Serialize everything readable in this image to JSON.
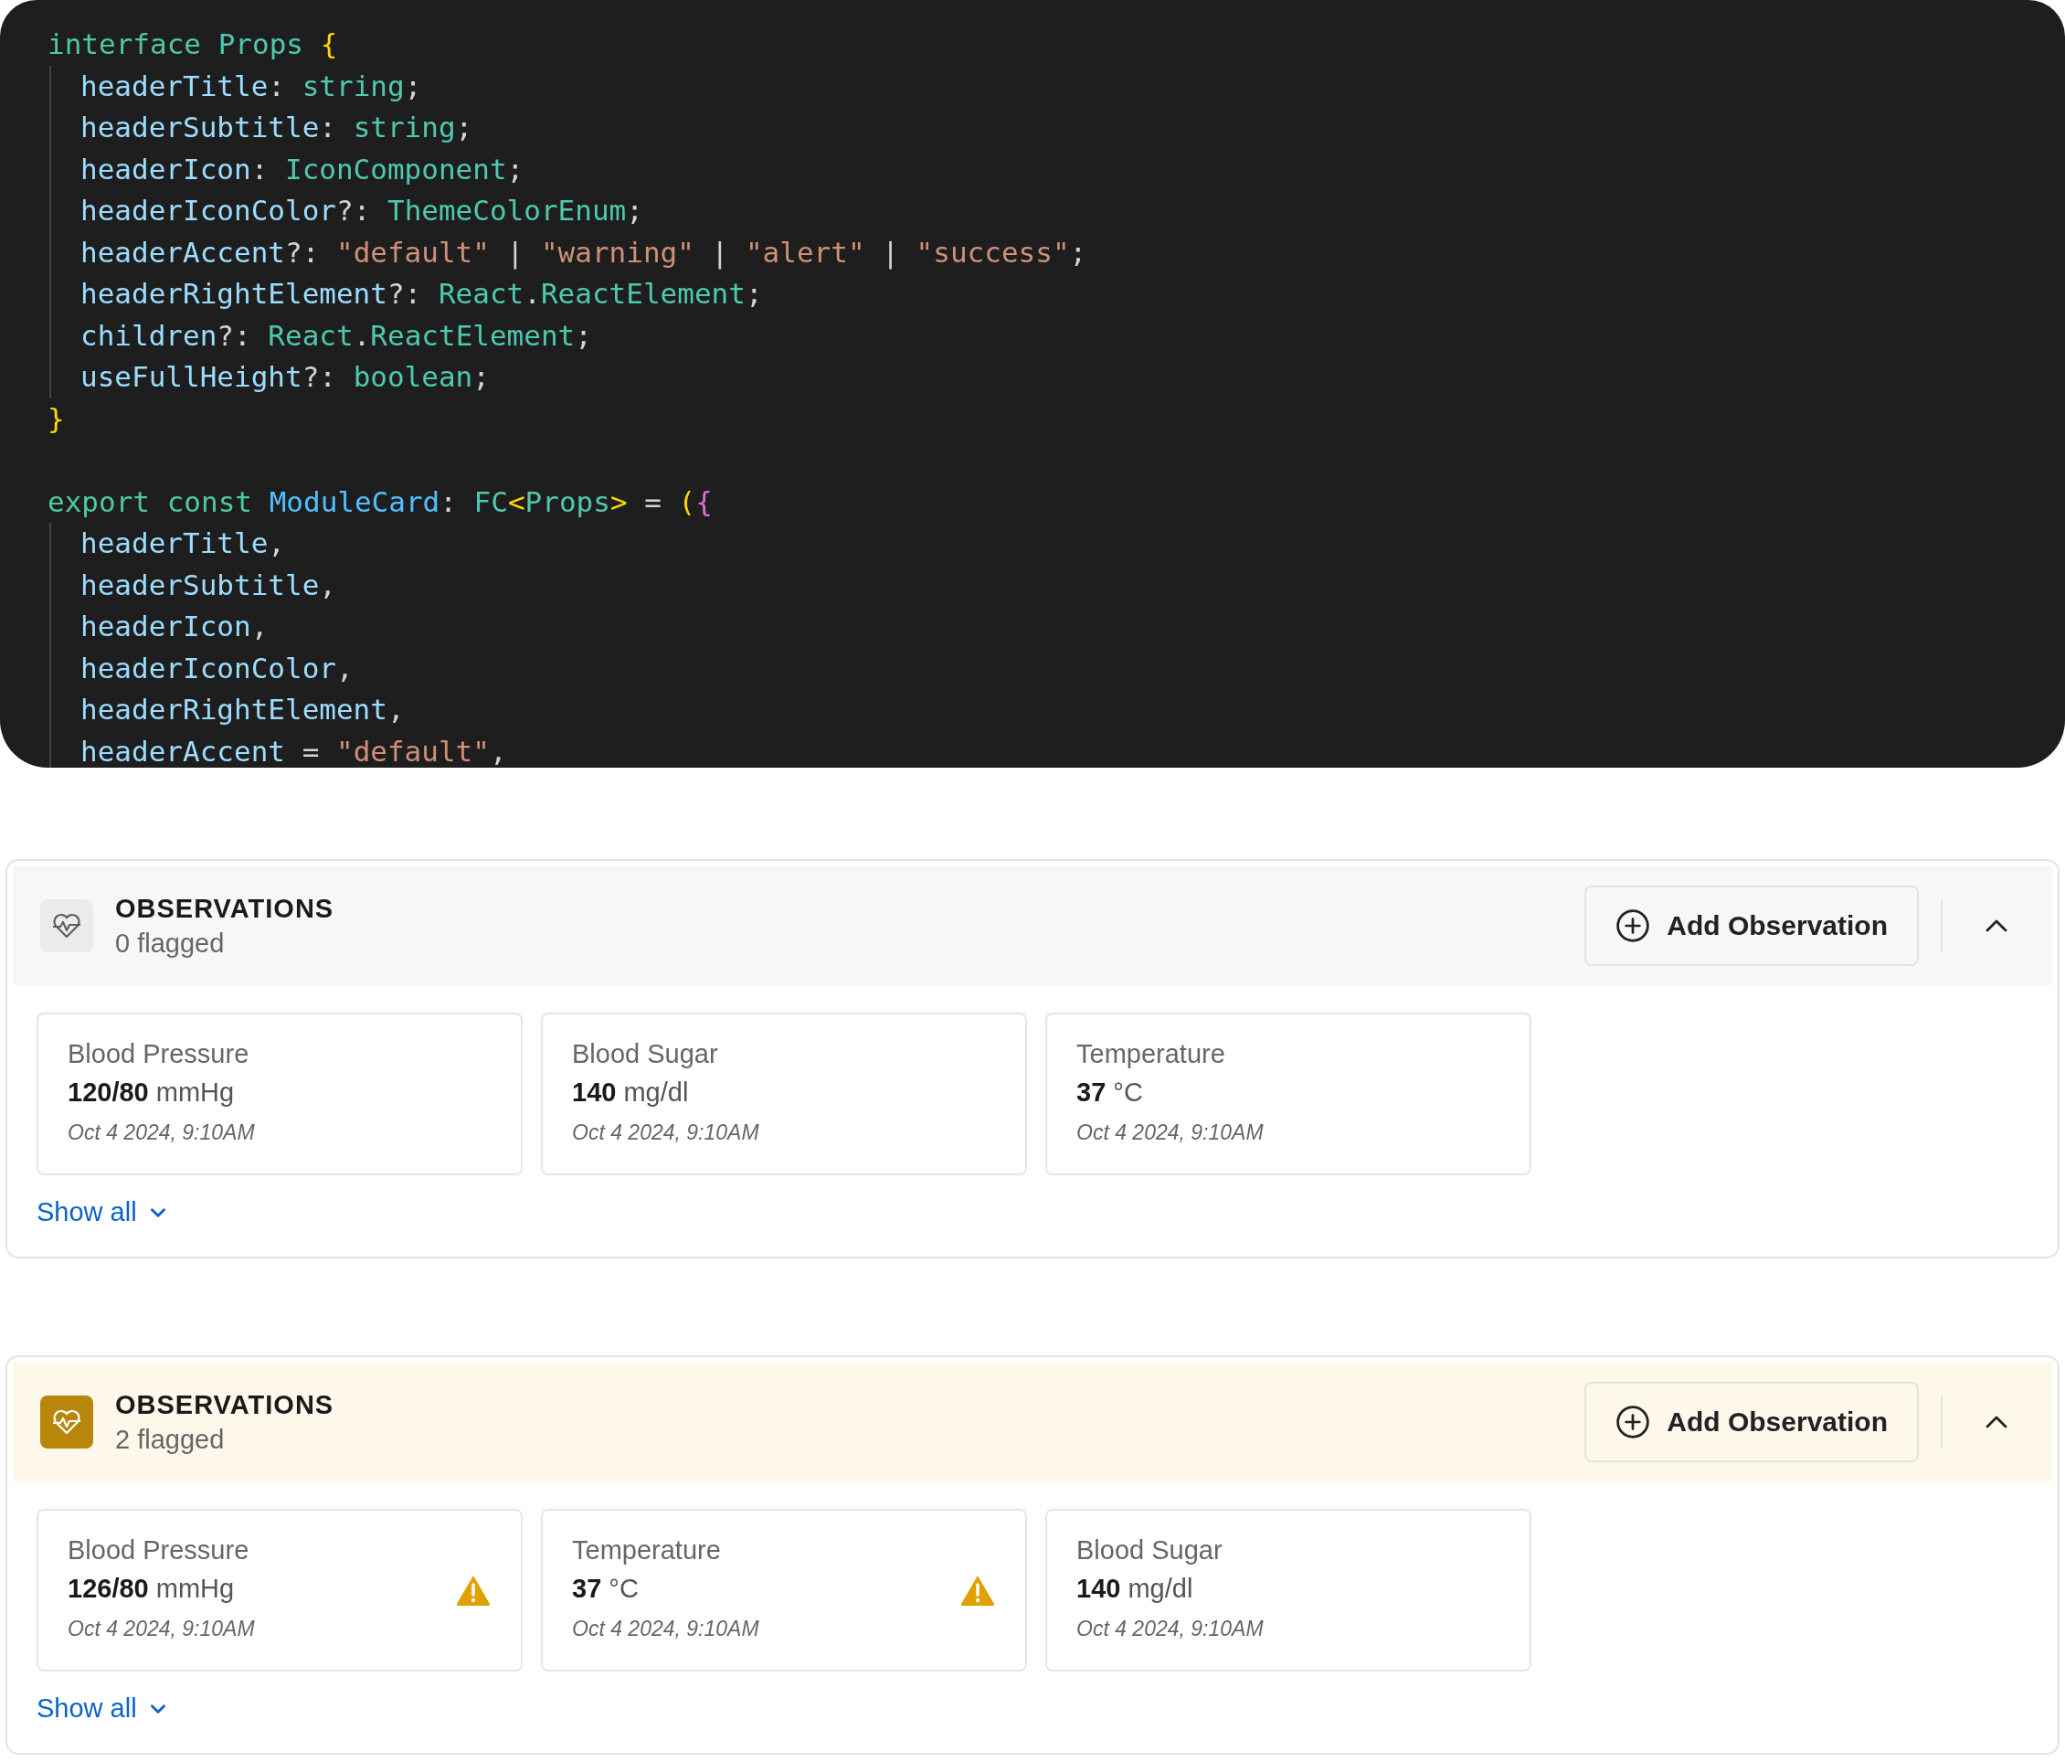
{
  "code": {
    "blocks": [
      {
        "head": [
          {
            "text": "interface ",
            "kind": "keyword"
          },
          {
            "text": "Props ",
            "kind": "type"
          },
          {
            "text": "{",
            "kind": "brace"
          }
        ],
        "children": [
          [
            {
              "text": "headerTitle",
              "kind": "prop"
            },
            {
              "text": ": ",
              "kind": "punct"
            },
            {
              "text": "string",
              "kind": "type"
            },
            {
              "text": ";",
              "kind": "punct"
            }
          ],
          [
            {
              "text": "headerSubtitle",
              "kind": "prop"
            },
            {
              "text": ": ",
              "kind": "punct"
            },
            {
              "text": "string",
              "kind": "type"
            },
            {
              "text": ";",
              "kind": "punct"
            }
          ],
          [
            {
              "text": "headerIcon",
              "kind": "prop"
            },
            {
              "text": ": ",
              "kind": "punct"
            },
            {
              "text": "IconComponent",
              "kind": "type"
            },
            {
              "text": ";",
              "kind": "punct"
            }
          ],
          [
            {
              "text": "headerIconColor",
              "kind": "prop"
            },
            {
              "text": "?: ",
              "kind": "punct"
            },
            {
              "text": "ThemeColorEnum",
              "kind": "type"
            },
            {
              "text": ";",
              "kind": "punct"
            }
          ],
          [
            {
              "text": "headerAccent",
              "kind": "prop"
            },
            {
              "text": "?: ",
              "kind": "punct"
            },
            {
              "text": "\"default\"",
              "kind": "string"
            },
            {
              "text": " | ",
              "kind": "punct"
            },
            {
              "text": "\"warning\"",
              "kind": "string"
            },
            {
              "text": " | ",
              "kind": "punct"
            },
            {
              "text": "\"alert\"",
              "kind": "string"
            },
            {
              "text": " | ",
              "kind": "punct"
            },
            {
              "text": "\"success\"",
              "kind": "string"
            },
            {
              "text": ";",
              "kind": "punct"
            }
          ],
          [
            {
              "text": "headerRightElement",
              "kind": "prop"
            },
            {
              "text": "?: ",
              "kind": "punct"
            },
            {
              "text": "React",
              "kind": "type"
            },
            {
              "text": ".",
              "kind": "punct"
            },
            {
              "text": "ReactElement",
              "kind": "type"
            },
            {
              "text": ";",
              "kind": "punct"
            }
          ],
          [
            {
              "text": "children",
              "kind": "prop"
            },
            {
              "text": "?: ",
              "kind": "punct"
            },
            {
              "text": "React",
              "kind": "type"
            },
            {
              "text": ".",
              "kind": "punct"
            },
            {
              "text": "ReactElement",
              "kind": "type"
            },
            {
              "text": ";",
              "kind": "punct"
            }
          ],
          [
            {
              "text": "useFullHeight",
              "kind": "prop"
            },
            {
              "text": "?: ",
              "kind": "punct"
            },
            {
              "text": "boolean",
              "kind": "type"
            },
            {
              "text": ";",
              "kind": "punct"
            }
          ]
        ],
        "tail": [
          {
            "text": "}",
            "kind": "brace"
          }
        ]
      },
      {
        "head": [
          {
            "text": "export ",
            "kind": "keyword"
          },
          {
            "text": "const ",
            "kind": "keyword"
          },
          {
            "text": "ModuleCard",
            "kind": "name"
          },
          {
            "text": ": ",
            "kind": "punct"
          },
          {
            "text": "FC",
            "kind": "type"
          },
          {
            "text": "<",
            "kind": "brace"
          },
          {
            "text": "Props",
            "kind": "type"
          },
          {
            "text": ">",
            "kind": "brace"
          },
          {
            "text": " = ",
            "kind": "punct"
          },
          {
            "text": "(",
            "kind": "brace"
          },
          {
            "text": "{",
            "kind": "brace2"
          }
        ],
        "children": [
          [
            {
              "text": "headerTitle",
              "kind": "prop"
            },
            {
              "text": ",",
              "kind": "punct"
            }
          ],
          [
            {
              "text": "headerSubtitle",
              "kind": "prop"
            },
            {
              "text": ",",
              "kind": "punct"
            }
          ],
          [
            {
              "text": "headerIcon",
              "kind": "prop"
            },
            {
              "text": ",",
              "kind": "punct"
            }
          ],
          [
            {
              "text": "headerIconColor",
              "kind": "prop"
            },
            {
              "text": ",",
              "kind": "punct"
            }
          ],
          [
            {
              "text": "headerRightElement",
              "kind": "prop"
            },
            {
              "text": ",",
              "kind": "punct"
            }
          ],
          [
            {
              "text": "headerAccent",
              "kind": "prop"
            },
            {
              "text": " = ",
              "kind": "punct"
            },
            {
              "text": "\"default\"",
              "kind": "string"
            },
            {
              "text": ",",
              "kind": "punct"
            }
          ]
        ]
      }
    ]
  },
  "modules": [
    {
      "kind": "default",
      "title": "OBSERVATIONS",
      "subtitle": "0 flagged",
      "button": "Add Observation",
      "expanded": true,
      "observations": [
        {
          "name": "Blood Pressure",
          "value": "120/80",
          "unit": "mmHg",
          "time": "Oct 4 2024, 9:10AM",
          "flagged": false
        },
        {
          "name": "Blood Sugar",
          "value": "140",
          "unit": "mg/dl",
          "time": "Oct 4 2024, 9:10AM",
          "flagged": false
        },
        {
          "name": "Temperature",
          "value": "37",
          "unit": "°C",
          "time": "Oct 4 2024, 9:10AM",
          "flagged": false
        }
      ],
      "link": "Show all"
    },
    {
      "kind": "warning",
      "title": "OBSERVATIONS",
      "subtitle": "2 flagged",
      "button": "Add Observation",
      "expanded": true,
      "observations": [
        {
          "name": "Blood Pressure",
          "value": "126/80",
          "unit": "mmHg",
          "time": "Oct 4 2024, 9:10AM",
          "flagged": true
        },
        {
          "name": "Temperature",
          "value": "37",
          "unit": "°C",
          "time": "Oct 4 2024, 9:10AM",
          "flagged": true
        },
        {
          "name": "Blood Sugar",
          "value": "140",
          "unit": "mg/dl",
          "time": "Oct 4 2024, 9:10AM",
          "flagged": false
        }
      ],
      "link": "Show all"
    }
  ]
}
